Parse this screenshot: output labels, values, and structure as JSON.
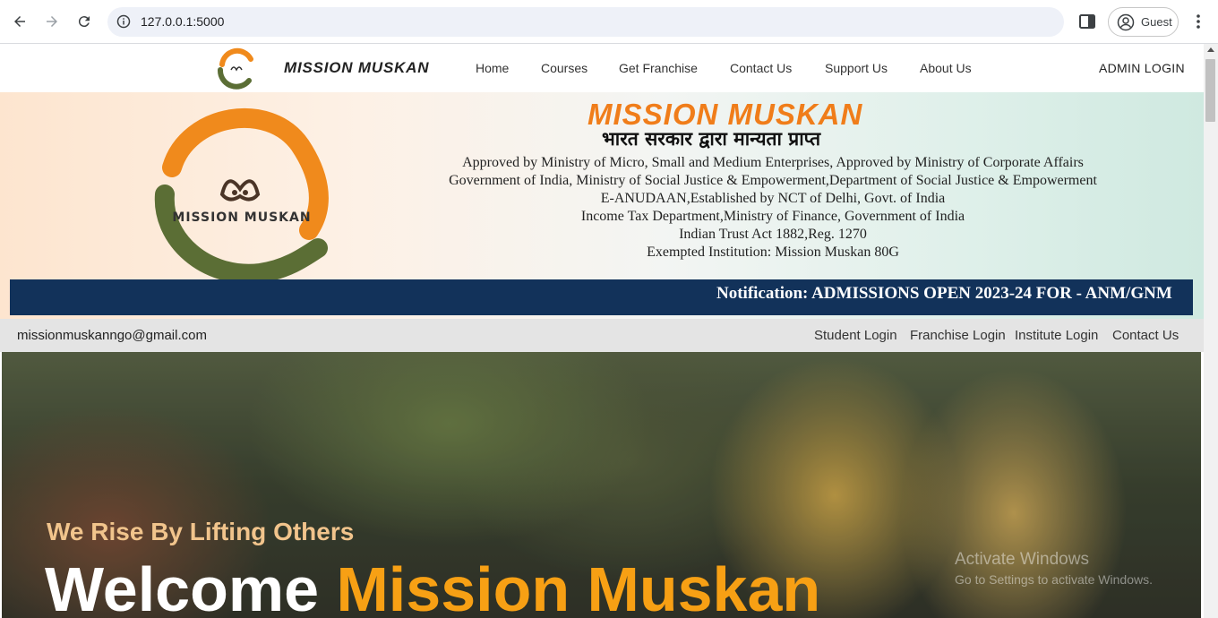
{
  "browser": {
    "url": "127.0.0.1:5000",
    "profile_label": "Guest"
  },
  "header": {
    "brand": "MISSION MUSKAN",
    "nav": [
      {
        "label": "Home"
      },
      {
        "label": "Courses"
      },
      {
        "label": "Get Franchise"
      },
      {
        "label": "Contact Us"
      },
      {
        "label": "Support Us"
      },
      {
        "label": "About Us"
      }
    ],
    "admin_login": "ADMIN LOGIN"
  },
  "banner": {
    "logo_text": "MISSION MUSKAN",
    "title": "MISSION MUSKAN",
    "hindi_line": "भारत सरकार द्वारा मान्यता प्राप्त",
    "approvals": [
      "Approved by Ministry of Micro, Small and Medium Enterprises, Approved by Ministry of Corporate Affairs",
      "Government of India, Ministry of Social Justice & Empowerment,Department of Social Justice & Empowerment",
      "E-ANUDAAN,Established by NCT of Delhi, Govt. of India",
      "Income Tax Department,Ministry of Finance, Government of India",
      "Indian Trust Act 1882,Reg. 1270",
      "Exempted Institution: Mission Muskan 80G"
    ],
    "notification": "Notification: ADMISSIONS OPEN 2023-24 FOR - ANM/GNM"
  },
  "info_strip": {
    "email": "missionmuskanngo@gmail.com",
    "links": [
      {
        "label": "Student Login"
      },
      {
        "label": "Franchise Login"
      },
      {
        "label": "Institute Login"
      },
      {
        "label": "Contact Us"
      }
    ]
  },
  "hero": {
    "tagline": "We Rise By Lifting Others",
    "welcome": "Welcome",
    "brand": "Mission Muskan"
  },
  "watermark": {
    "title": "Activate Windows",
    "subtitle": "Go to Settings to activate Windows."
  },
  "colors": {
    "accent_orange": "#f07d1a",
    "notification_bg": "#12325a",
    "hero_brand": "#f7a014",
    "logo_green": "#5a6b2e"
  }
}
